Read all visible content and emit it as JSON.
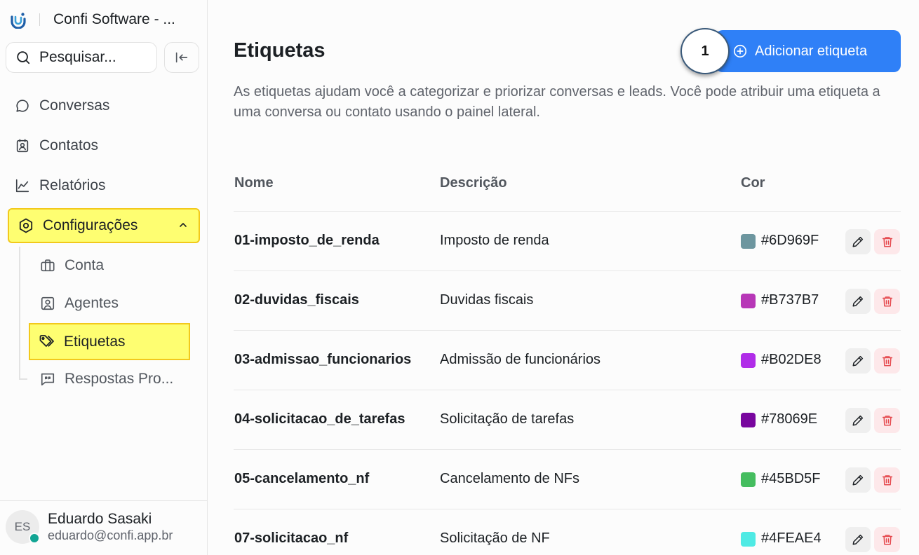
{
  "app": {
    "title": "Confi Software - ..."
  },
  "search": {
    "placeholder": "Pesquisar..."
  },
  "sidebar": {
    "items": [
      {
        "label": "Conversas",
        "icon": "chat-bubble-icon"
      },
      {
        "label": "Contatos",
        "icon": "contact-card-icon"
      },
      {
        "label": "Relatórios",
        "icon": "line-chart-icon"
      },
      {
        "label": "Configurações",
        "icon": "settings-hexagon-icon",
        "expanded": true
      }
    ],
    "sub_items": [
      {
        "label": "Conta",
        "icon": "briefcase-icon"
      },
      {
        "label": "Agentes",
        "icon": "user-square-icon"
      },
      {
        "label": "Etiquetas",
        "icon": "tags-icon",
        "active": true
      },
      {
        "label": "Respostas Pro...",
        "icon": "message-square-quote-icon"
      }
    ]
  },
  "user": {
    "initials": "ES",
    "name": "Eduardo Sasaki",
    "email": "eduardo@confi.app.br",
    "status": "online"
  },
  "main": {
    "title": "Etiquetas",
    "add_button": "Adicionar etiqueta",
    "step_marker": "1",
    "description": "As etiquetas ajudam você a categorizar e priorizar conversas e leads. Você pode atribuir uma etiqueta a uma conversa ou contato usando o painel lateral.",
    "columns": {
      "name": "Nome",
      "description": "Descrição",
      "color": "Cor"
    },
    "rows": [
      {
        "name": "01-imposto_de_renda",
        "description": "Imposto de renda",
        "color": "#6D969F"
      },
      {
        "name": "02-duvidas_fiscais",
        "description": "Duvidas fiscais",
        "color": "#B737B7"
      },
      {
        "name": "03-admissao_funcionarios",
        "description": "Admissão de funcionários",
        "color": "#B02DE8"
      },
      {
        "name": "04-solicitacao_de_tarefas",
        "description": "Solicitação de tarefas",
        "color": "#78069E"
      },
      {
        "name": "05-cancelamento_nf",
        "description": "Cancelamento de NFs",
        "color": "#45BD5F"
      },
      {
        "name": "07-solicitacao_nf",
        "description": "Solicitação de NF",
        "color": "#4FEAE4"
      }
    ]
  },
  "colors": {
    "accent": "#2F80F7",
    "highlight": "#FEFE71",
    "highlight_border": "#F2C91C",
    "danger": "#E5484D"
  }
}
